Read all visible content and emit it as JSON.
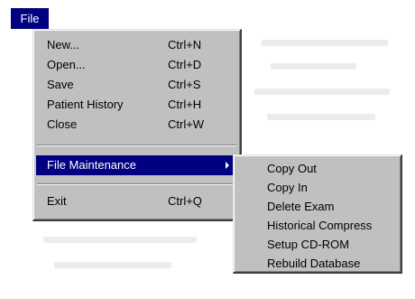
{
  "menubar": {
    "file": {
      "label": "File",
      "mnemonic": "F"
    }
  },
  "file_menu": {
    "items": [
      {
        "label": "New...",
        "shortcut": "Ctrl+N"
      },
      {
        "label": "Open...",
        "shortcut": "Ctrl+D"
      },
      {
        "label": "Save",
        "shortcut": "Ctrl+S"
      },
      {
        "label": "Patient History",
        "shortcut": "Ctrl+H"
      },
      {
        "label": "Close",
        "shortcut": "Ctrl+W"
      },
      {
        "label": "File Maintenance",
        "shortcut": ""
      },
      {
        "label": "Exit",
        "shortcut": "Ctrl+Q"
      }
    ]
  },
  "submenu": {
    "items": [
      {
        "label": "Copy Out"
      },
      {
        "label": "Copy In"
      },
      {
        "label": "Delete Exam"
      },
      {
        "label": "Historical Compress"
      },
      {
        "label": "Setup CD-ROM"
      },
      {
        "label": "Rebuild Database"
      }
    ]
  },
  "colors": {
    "menu_bg": "#c0c0c0",
    "highlight": "#000080",
    "highlight_text": "#ffffff"
  }
}
